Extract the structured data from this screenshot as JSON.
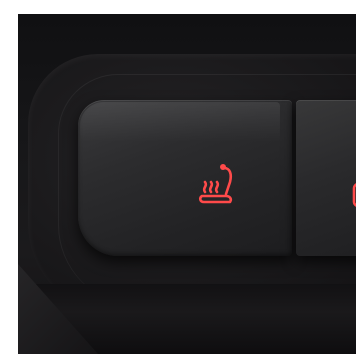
{
  "scene": {
    "icons": {
      "seat_heat": "seat-heater-icon",
      "right_button": "partial-icon"
    },
    "colors": {
      "icon_glow": "#ff4a4a",
      "panel": "#1b1a1c",
      "button": "#2c2c2e",
      "frame": "#ffffff"
    }
  }
}
